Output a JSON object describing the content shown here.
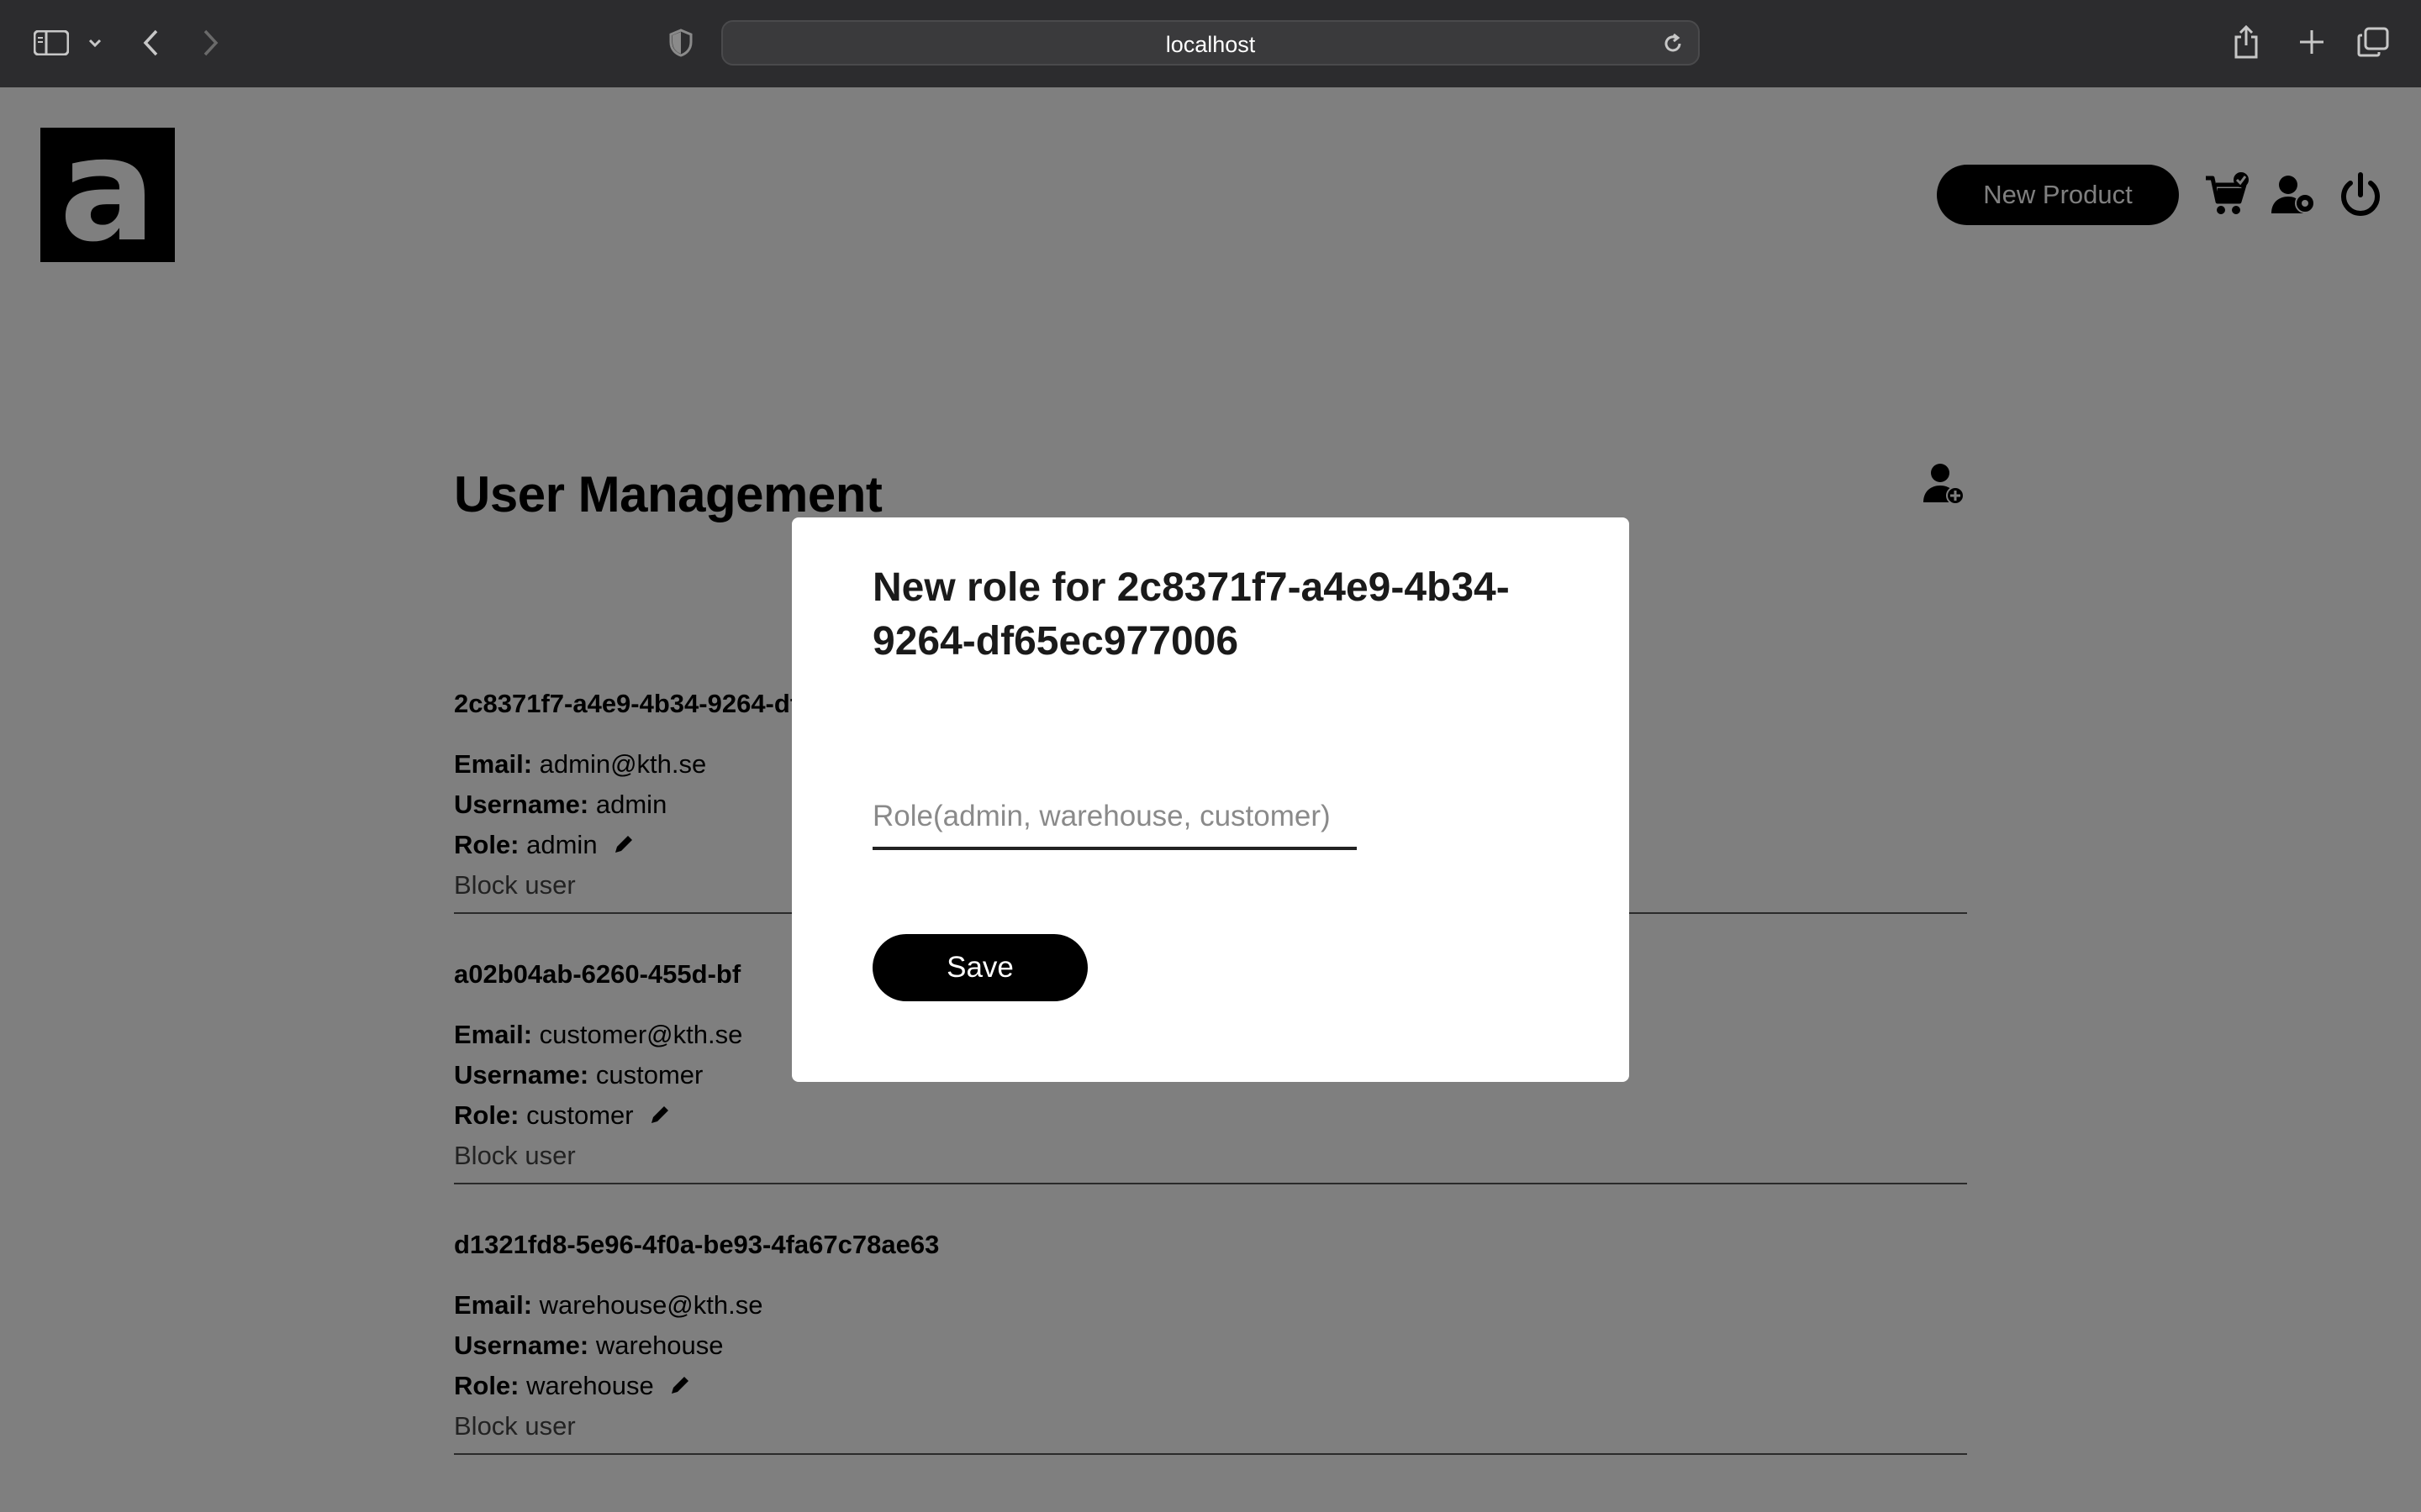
{
  "browser": {
    "url": "localhost"
  },
  "header": {
    "logo_letter": "a",
    "new_product_label": "New Product"
  },
  "main": {
    "title": "User Management",
    "users": [
      {
        "id": "2c8371f7-a4e9-4b34-9264-df65ec977006",
        "email_label": "Email:",
        "email": "admin@kth.se",
        "username_label": "Username:",
        "username": "admin",
        "role_label": "Role:",
        "role": "admin",
        "block_label": "Block user"
      },
      {
        "id": "a02b04ab-6260-455d-bf",
        "email_label": "Email:",
        "email": "customer@kth.se",
        "username_label": "Username:",
        "username": "customer",
        "role_label": "Role:",
        "role": "customer",
        "block_label": "Block user"
      },
      {
        "id": "d1321fd8-5e96-4f0a-be93-4fa67c78ae63",
        "email_label": "Email:",
        "email": "warehouse@kth.se",
        "username_label": "Username:",
        "username": "warehouse",
        "role_label": "Role:",
        "role": "warehouse",
        "block_label": "Block user"
      }
    ]
  },
  "modal": {
    "title": "New role for 2c8371f7-a4e9-4b34-9264-df65ec977006",
    "role_placeholder": "Role(admin, warehouse, customer)",
    "role_value": "",
    "save_label": "Save"
  }
}
